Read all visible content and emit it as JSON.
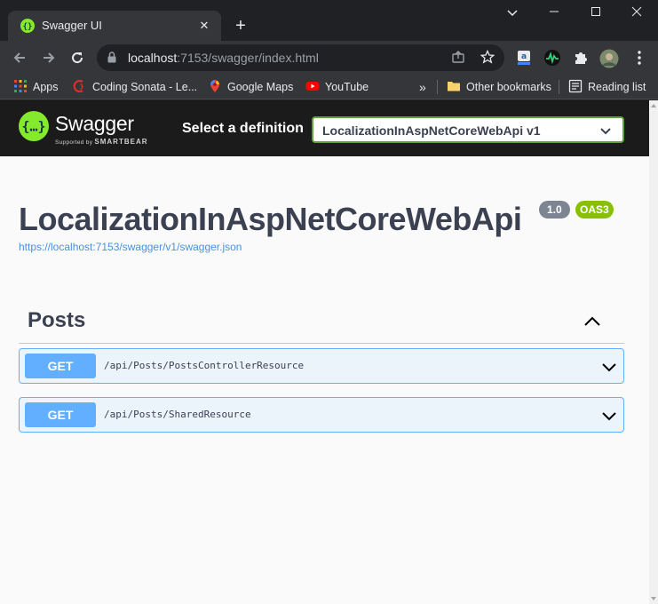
{
  "browser": {
    "tab_title": "Swagger UI",
    "url_host": "localhost",
    "url_rest": ":7153/swagger/index.html",
    "bookmarks": [
      {
        "label": "Apps"
      },
      {
        "label": "Coding Sonata - Le..."
      },
      {
        "label": "Google Maps"
      },
      {
        "label": "YouTube"
      }
    ],
    "overflow": "»",
    "other_bookmarks": "Other bookmarks",
    "reading_list": "Reading list"
  },
  "topbar": {
    "brand": "Swagger",
    "supported_by": "Supported by",
    "supporter": "SMARTBEAR",
    "select_label": "Select a definition",
    "selected_definition": "LocalizationInAspNetCoreWebApi v1"
  },
  "info": {
    "title": "LocalizationInAspNetCoreWebApi",
    "version": "1.0",
    "oas": "OAS3",
    "spec_url": "https://localhost:7153/swagger/v1/swagger.json"
  },
  "section": {
    "title": "Posts",
    "operations": [
      {
        "method": "GET",
        "path": "/api/Posts/PostsControllerResource"
      },
      {
        "method": "GET",
        "path": "/api/Posts/SharedResource"
      }
    ]
  },
  "colors": {
    "swagger_green": "#85ea2d",
    "get_blue": "#61affe",
    "oas_green": "#89bf04"
  }
}
